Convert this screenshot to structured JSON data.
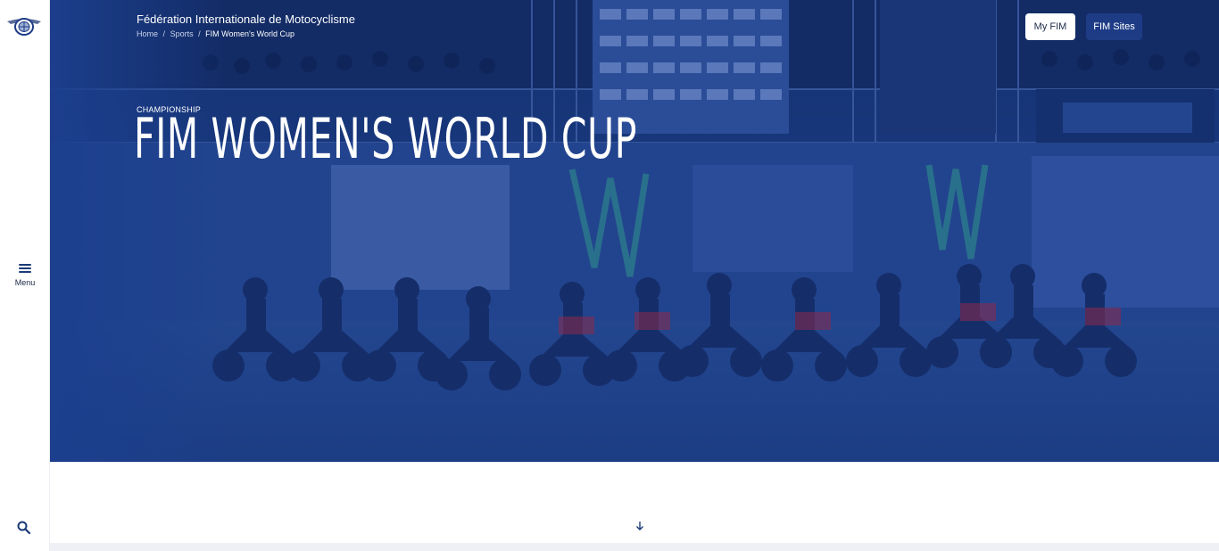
{
  "org": {
    "name": "Fédération Internationale de Motocyclisme"
  },
  "breadcrumb": {
    "items": [
      "Home",
      "Sports"
    ],
    "current": "FIM Women's World Cup",
    "separator": "/"
  },
  "hero": {
    "eyebrow": "CHAMPIONSHIP",
    "title": "FIM WOMEN'S WORLD CUP",
    "image_label": "motocross-race-start-photo",
    "overlay_color": "#1c3f8e"
  },
  "header_buttons": {
    "my_fim": "My FIM",
    "fim_sites": "FIM Sites"
  },
  "sidebar": {
    "logo": "fim-logo",
    "menu_label": "Menu",
    "menu_icon": "hamburger-icon",
    "search_icon": "search-icon"
  },
  "scroll": {
    "icon": "arrow-down-icon"
  },
  "colors": {
    "brand": "#1e3c86",
    "overlay": "#1c3f8e",
    "text_dark": "#1c2a46"
  }
}
